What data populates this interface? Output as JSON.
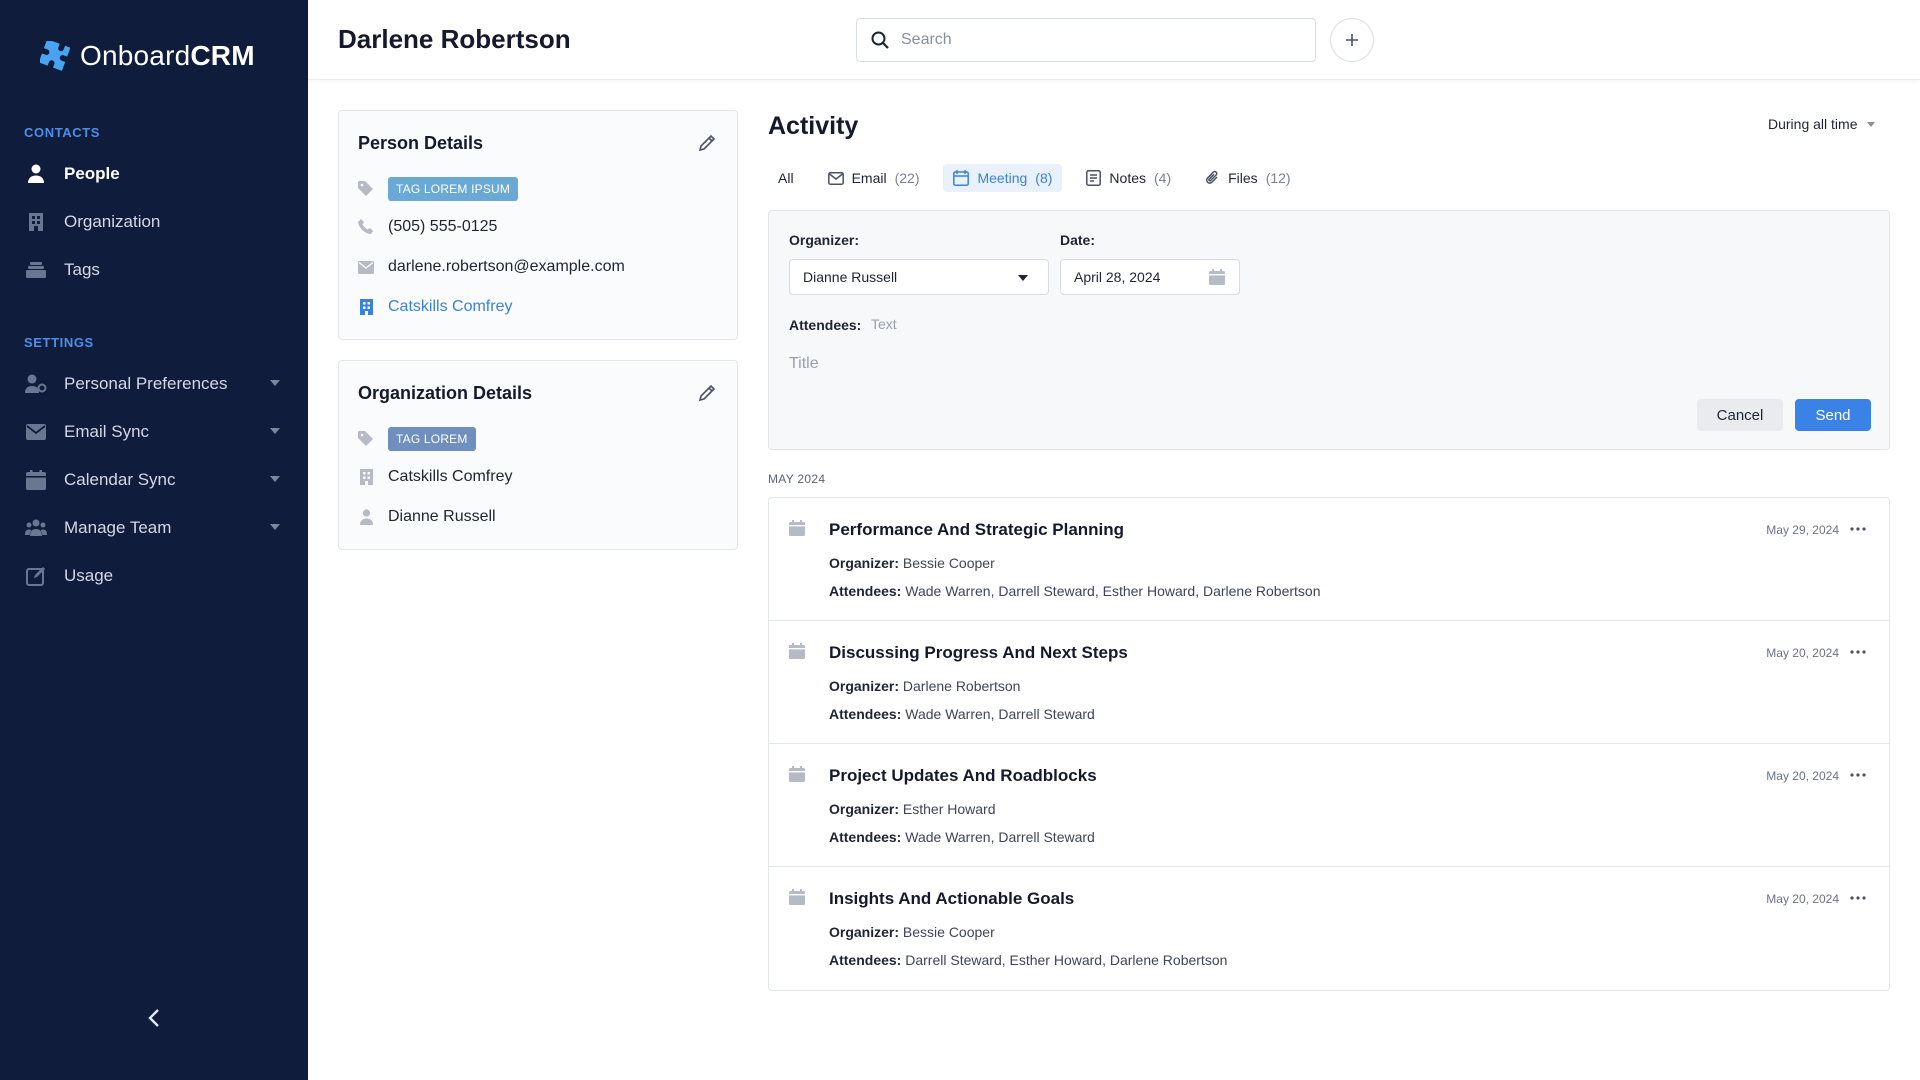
{
  "app": {
    "brand_light": "Onboard",
    "brand_bold": "CRM"
  },
  "sidebar": {
    "contacts_label": "CONTACTS",
    "contacts": [
      {
        "label": "People",
        "icon": "person-icon",
        "active": true
      },
      {
        "label": "Organization",
        "icon": "building-icon"
      },
      {
        "label": "Tags",
        "icon": "tags-icon"
      }
    ],
    "settings_label": "SETTINGS",
    "settings": [
      {
        "label": "Personal Preferences",
        "icon": "user-settings-icon"
      },
      {
        "label": "Email Sync",
        "icon": "envelope-icon"
      },
      {
        "label": "Calendar Sync",
        "icon": "calendar-icon"
      },
      {
        "label": "Manage Team",
        "icon": "team-icon"
      },
      {
        "label": "Usage",
        "icon": "edit-square-icon"
      }
    ]
  },
  "header": {
    "title": "Darlene Robertson",
    "search_placeholder": "Search"
  },
  "person": {
    "title": "Person Details",
    "tag": "TAG LOREM IPSUM",
    "phone": "(505) 555-0125",
    "email": "darlene.robertson@example.com",
    "organization": "Catskills Comfrey"
  },
  "org": {
    "title": "Organization Details",
    "tag": "TAG LOREM",
    "name": "Catskills Comfrey",
    "contact": "Dianne Russell"
  },
  "activity": {
    "title": "Activity",
    "period": "During all time",
    "tabs": [
      {
        "label": "All",
        "count": ""
      },
      {
        "label": "Email",
        "count": "(22)"
      },
      {
        "label": "Meeting",
        "count": "(8)"
      },
      {
        "label": "Notes",
        "count": "(4)"
      },
      {
        "label": "Files",
        "count": "(12)"
      }
    ],
    "form": {
      "organizer_label": "Organizer:",
      "organizer_value": "Dianne Russell",
      "date_label": "Date:",
      "date_value": "April 28, 2024",
      "attendees_label": "Attendees:",
      "attendees_placeholder": "Text",
      "title_placeholder": "Title",
      "cancel": "Cancel",
      "send": "Send"
    },
    "month": "MAY 2024",
    "organizer_prefix": "Organizer:",
    "attendees_prefix": "Attendees:",
    "items": [
      {
        "title": "Performance And Strategic Planning",
        "organizer": "Bessie Cooper",
        "attendees": "Wade Warren, Darrell Steward, Esther Howard, Darlene Robertson",
        "date": "May 29, 2024"
      },
      {
        "title": "Discussing Progress And Next Steps",
        "organizer": "Darlene Robertson",
        "attendees": "Wade Warren, Darrell Steward",
        "date": "May 20, 2024"
      },
      {
        "title": "Project Updates And Roadblocks",
        "organizer": "Esther Howard",
        "attendees": "Wade Warren, Darrell Steward",
        "date": "May 20, 2024"
      },
      {
        "title": "Insights And Actionable Goals",
        "organizer": "Bessie Cooper",
        "attendees": "Darrell Steward, Esther Howard, Darlene Robertson",
        "date": "May 20, 2024"
      }
    ]
  },
  "colors": {
    "sidebar_bg": "#101c3b",
    "accent": "#3b82e6",
    "tag": "#6aa8d6"
  }
}
